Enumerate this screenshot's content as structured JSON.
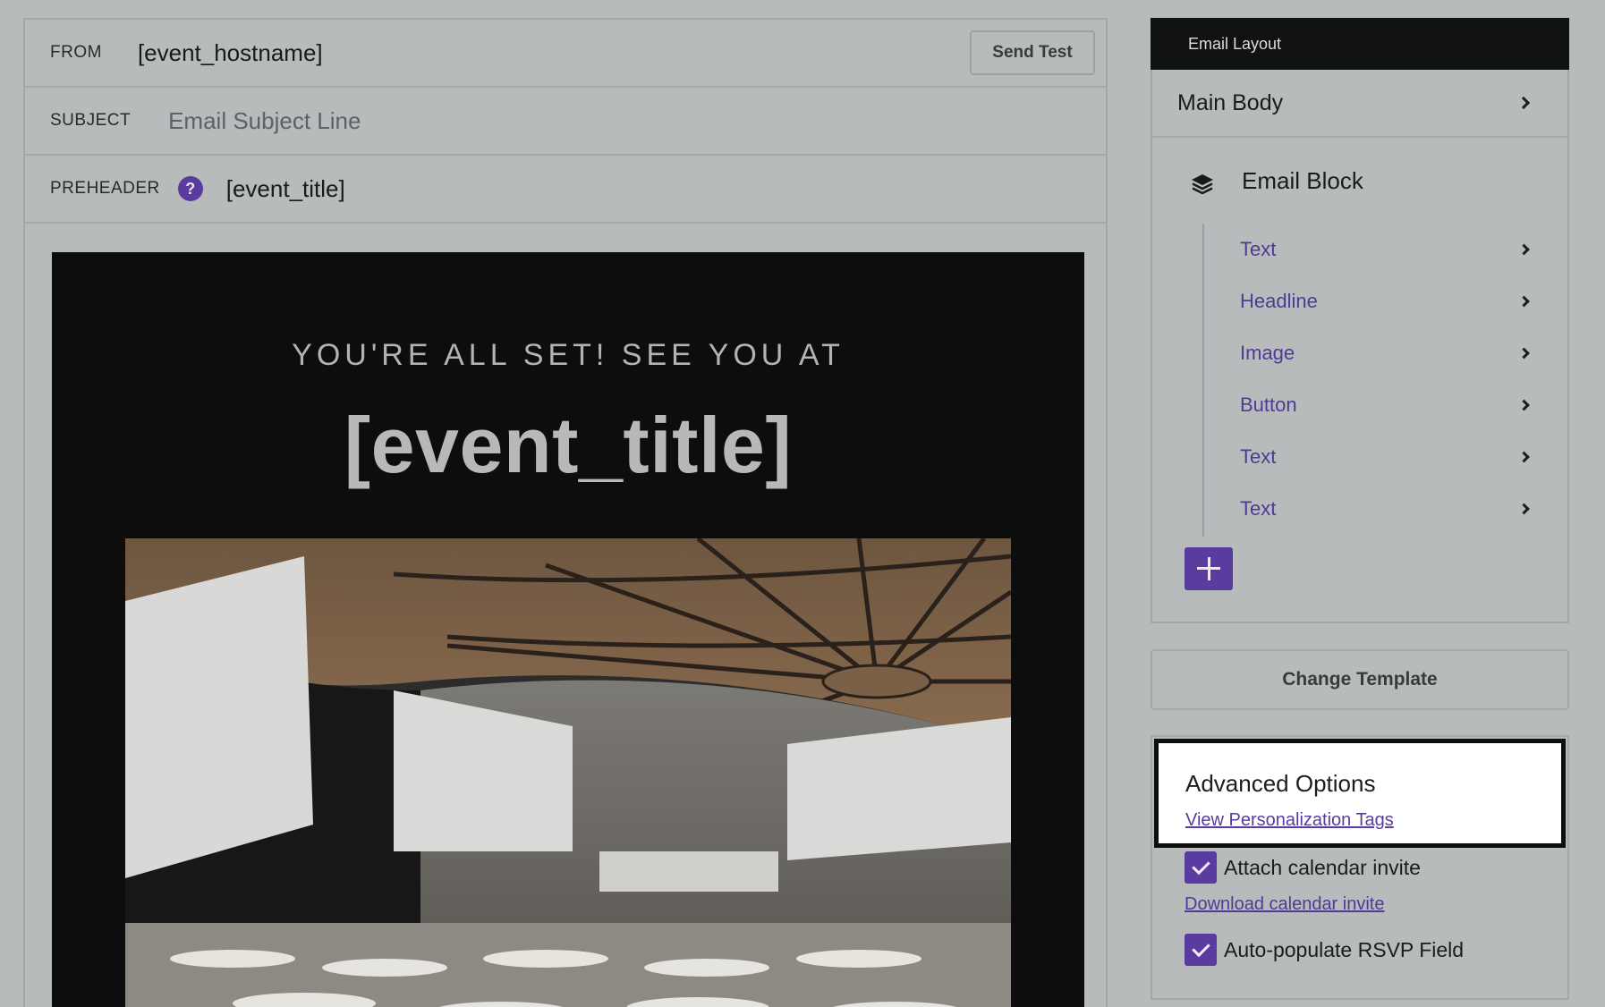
{
  "editor": {
    "from_label": "FROM",
    "from_value": "[event_hostname]",
    "send_test_label": "Send Test",
    "subject_label": "SUBJECT",
    "subject_placeholder": "Email Subject Line",
    "preheader_label": "PREHEADER",
    "preheader_help": "?",
    "preheader_value": "[event_title]"
  },
  "preview": {
    "kicker": "YOU'RE ALL SET! SEE YOU AT",
    "title": "[event_title]"
  },
  "layout": {
    "header": "Email Layout",
    "main_body": "Main Body",
    "block_title": "Email Block",
    "items": [
      {
        "label": "Text"
      },
      {
        "label": "Headline"
      },
      {
        "label": "Image"
      },
      {
        "label": "Button"
      },
      {
        "label": "Text"
      },
      {
        "label": "Text"
      }
    ]
  },
  "actions": {
    "change_template": "Change Template"
  },
  "advanced": {
    "title": "Advanced Options",
    "personalization_link": "View Personalization Tags",
    "attach_invite_label": "Attach calendar invite",
    "attach_invite_checked": true,
    "download_invite_link": "Download calendar invite",
    "autopopulate_label": "Auto-populate RSVP Field",
    "autopopulate_checked": true
  },
  "colors": {
    "accent": "#5a3ca0",
    "overlay_gray": "#b7bbbc",
    "header_dark": "#0f1112"
  }
}
